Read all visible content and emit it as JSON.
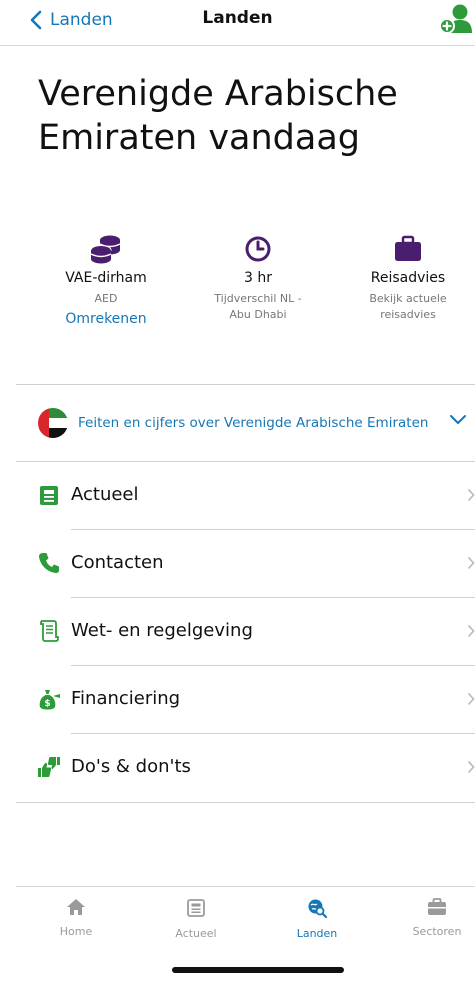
{
  "nav": {
    "back_label": "Landen",
    "title": "Landen"
  },
  "headline": "Verenigde Arabische Emiraten vandaag",
  "info": [
    {
      "title": "VAE-dirham",
      "sub": "AED",
      "link": "Omrekenen"
    },
    {
      "title": "3 hr",
      "sub": "Tijdverschil NL - Abu Dhabi"
    },
    {
      "title": "Reisadvies",
      "sub": "Bekijk actuele reisadvies"
    }
  ],
  "facts": {
    "label": "Feiten en cijfers over Verenigde Arabische Emiraten"
  },
  "menu": [
    {
      "label": "Actueel"
    },
    {
      "label": "Contacten"
    },
    {
      "label": "Wet- en regelgeving"
    },
    {
      "label": "Financiering"
    },
    {
      "label": "Do's & don'ts"
    }
  ],
  "tabs": [
    {
      "label": "Home"
    },
    {
      "label": "Actueel"
    },
    {
      "label": "Landen"
    },
    {
      "label": "Sectoren"
    }
  ],
  "colors": {
    "accent": "#1677b6",
    "icon_green": "#2e9b3a",
    "icon_purple": "#4a1e6e"
  }
}
